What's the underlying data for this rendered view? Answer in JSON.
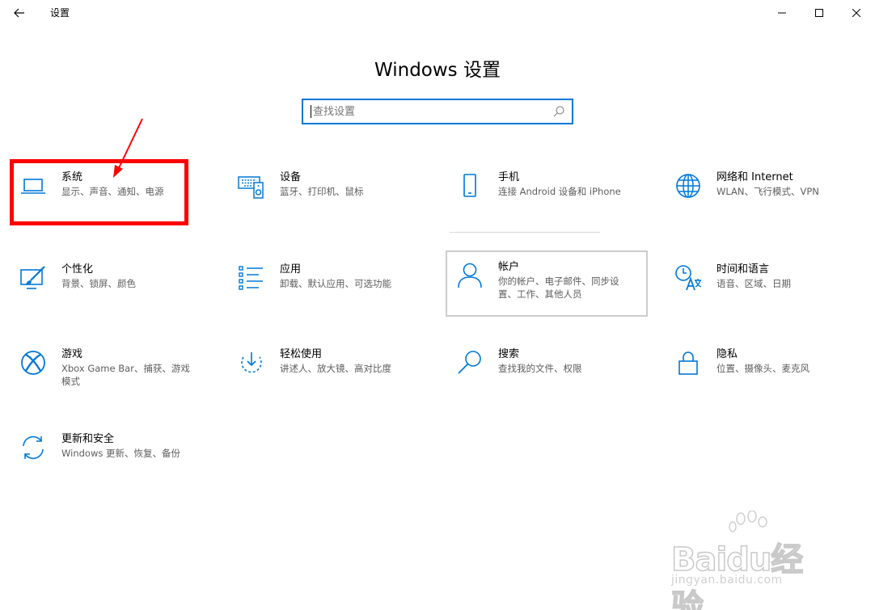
{
  "window": {
    "title": "设置",
    "back_icon": "back-arrow-icon",
    "controls": [
      "minimize-icon",
      "maximize-icon",
      "close-icon"
    ]
  },
  "main": {
    "heading": "Windows 设置",
    "search": {
      "placeholder": "查找设置",
      "value": "",
      "icon": "search-icon"
    }
  },
  "tiles": [
    {
      "title": "系统",
      "desc": "显示、声音、通知、电源",
      "icon": "laptop-icon"
    },
    {
      "title": "设备",
      "desc": "蓝牙、打印机、鼠标",
      "icon": "keyboard-speaker-icon"
    },
    {
      "title": "手机",
      "desc": "连接 Android 设备和 iPhone",
      "icon": "phone-icon"
    },
    {
      "title": "网络和 Internet",
      "desc": "WLAN、飞行模式、VPN",
      "icon": "globe-icon"
    },
    {
      "title": "个性化",
      "desc": "背景、锁屏、颜色",
      "icon": "paint-monitor-icon"
    },
    {
      "title": "应用",
      "desc": "卸载、默认应用、可选功能",
      "icon": "app-list-icon"
    },
    {
      "title": "帐户",
      "desc": "你的帐户、电子邮件、同步设置、工作、其他人员",
      "icon": "person-icon"
    },
    {
      "title": "时间和语言",
      "desc": "语音、区域、日期",
      "icon": "time-language-icon"
    },
    {
      "title": "游戏",
      "desc": "Xbox Game Bar、捕获、游戏模式",
      "icon": "xbox-icon"
    },
    {
      "title": "轻松使用",
      "desc": "讲述人、放大镜、高对比度",
      "icon": "ease-of-access-icon"
    },
    {
      "title": "搜索",
      "desc": "查找我的文件、权限",
      "icon": "magnifier-icon"
    },
    {
      "title": "隐私",
      "desc": "位置、摄像头、麦克风",
      "icon": "lock-icon"
    },
    {
      "title": "更新和安全",
      "desc": "Windows 更新、恢复、备份",
      "icon": "update-sync-icon"
    }
  ],
  "colors": {
    "accent": "#0078d7",
    "annotation": "#ff0000"
  },
  "watermark": {
    "brand": "Baidu经验",
    "url": "jingyan.baidu.com"
  }
}
